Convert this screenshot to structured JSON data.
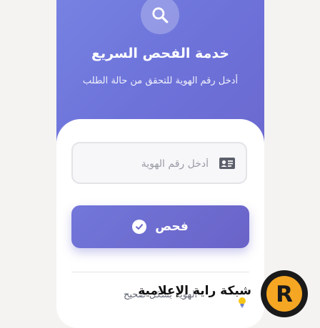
{
  "header": {
    "title": "خدمة الفحص السريع",
    "subtitle": "أدخل رقم الهوية للتحقق من حالة الطلب",
    "icon": "search-icon"
  },
  "form": {
    "id_placeholder": "أدخل رقم الهوية",
    "id_value": "",
    "id_icon": "id-card-icon",
    "check_label": "فحص",
    "check_icon": "check-circle-icon"
  },
  "hint": {
    "text": "الهوية بشكل صحيح",
    "icon": "lightbulb-icon"
  },
  "watermark": {
    "text": "شبكة راية الإعلامية",
    "logo_letter": "R"
  },
  "colors": {
    "accent": "#6d6fd6",
    "accent_dark": "#6a63c8",
    "logo_orange": "#f5a623"
  }
}
